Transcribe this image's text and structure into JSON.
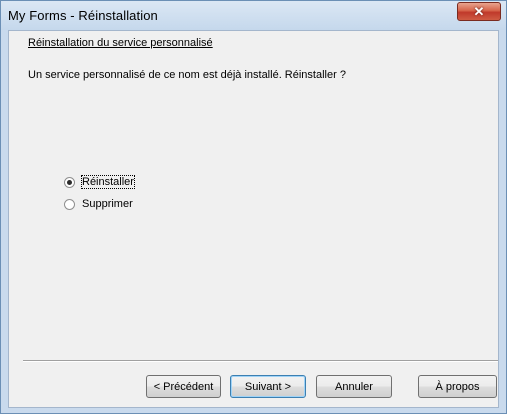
{
  "window": {
    "title": "My Forms - Réinstallation",
    "close_label": "✕"
  },
  "page": {
    "heading": "Réinstallation du service personnalisé",
    "message": "Un service personnalisé de ce nom est déjà installé. Réinstaller ?"
  },
  "options": {
    "selected": "Réinstaller",
    "items": [
      {
        "label": "Réinstaller",
        "checked": true
      },
      {
        "label": "Supprimer",
        "checked": false
      }
    ]
  },
  "buttons": {
    "previous": "< Précédent",
    "next": "Suivant >",
    "cancel": "Annuler",
    "about": "À propos"
  },
  "colors": {
    "title_bar": "#c9daed",
    "client_bg": "#f0f0f0",
    "close_button": "#c0392b",
    "default_button_border": "#3c7fb1"
  }
}
